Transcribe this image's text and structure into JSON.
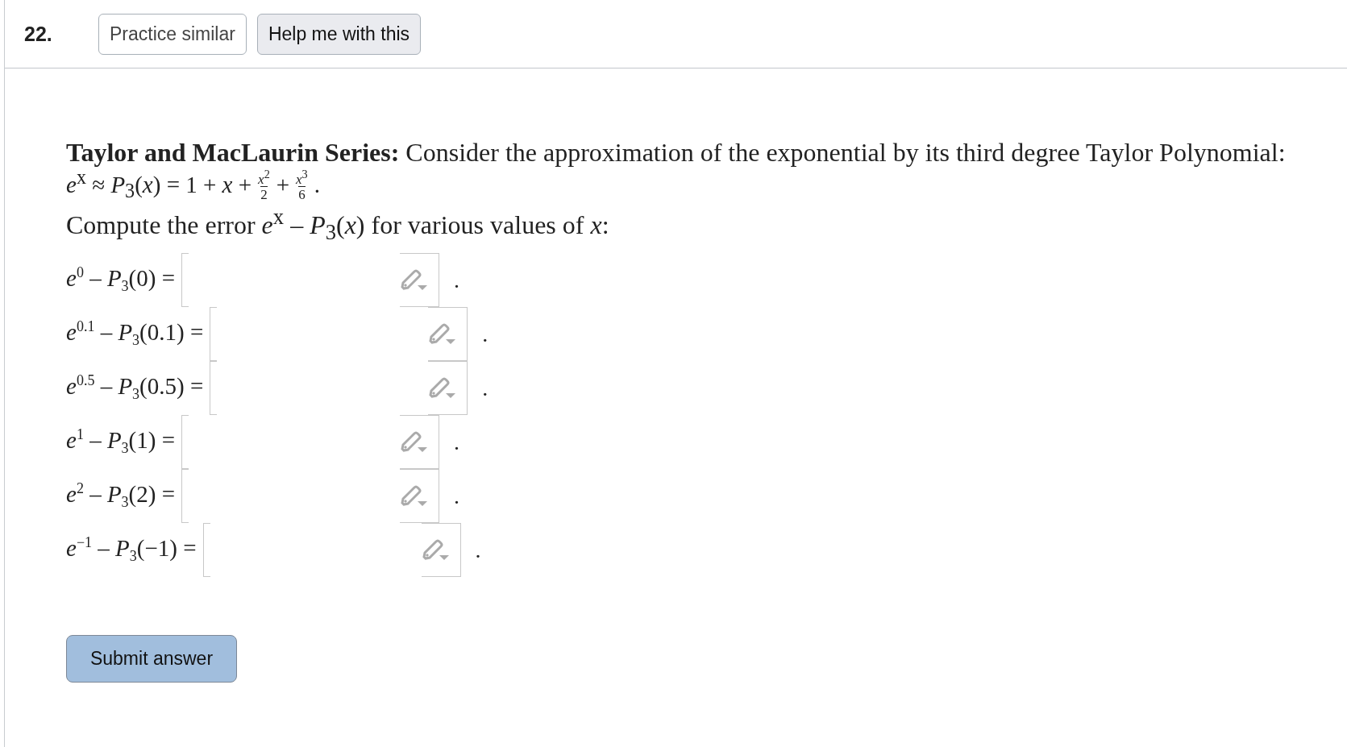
{
  "question_number": "22.",
  "header_buttons": [
    {
      "label": "Practice similar",
      "kind": "outline"
    },
    {
      "label": "Help me with this",
      "kind": "filled"
    }
  ],
  "problem": {
    "title": "Taylor and MacLaurin Series:",
    "intro": "Consider the approximation of the exponential by its third degree Taylor Polynomial:",
    "formula": [
      {
        "kind": "text",
        "text": "*e*$^{x}$ ≈ *P*$_{3}$(*x*) = 1 + *x* +"
      },
      {
        "kind": "fraction",
        "num": "*x*$^{2}$",
        "den": "2"
      },
      {
        "kind": "text",
        "text": "+"
      },
      {
        "kind": "fraction",
        "num": "*x*$^{3}$",
        "den": "6"
      },
      {
        "kind": "text",
        "text": "."
      }
    ],
    "instruction": "Compute the error *e*$^{x}$ – *P*$_{3}$(*x*) for various values of *x*:"
  },
  "answers": [
    {
      "label": "*e*$^{0}$ – *P*$_{3}$(0) =",
      "after": "."
    },
    {
      "label": "*e*$^{0.1}$ – *P*$_{3}$(0.1) =",
      "after": "."
    },
    {
      "label": "*e*$^{0.5}$ – *P*$_{3}$(0.5) =",
      "after": "."
    },
    {
      "label": "*e*$^{1}$ – *P*$_{3}$(1) =",
      "after": "."
    },
    {
      "label": "*e*$^{2}$ – *P*$_{3}$(2) =",
      "after": "."
    },
    {
      "label": "*e*$^{−1}$ – *P*$_{3}$(−1) =",
      "after": "."
    }
  ],
  "submit_button": "Submit answer"
}
